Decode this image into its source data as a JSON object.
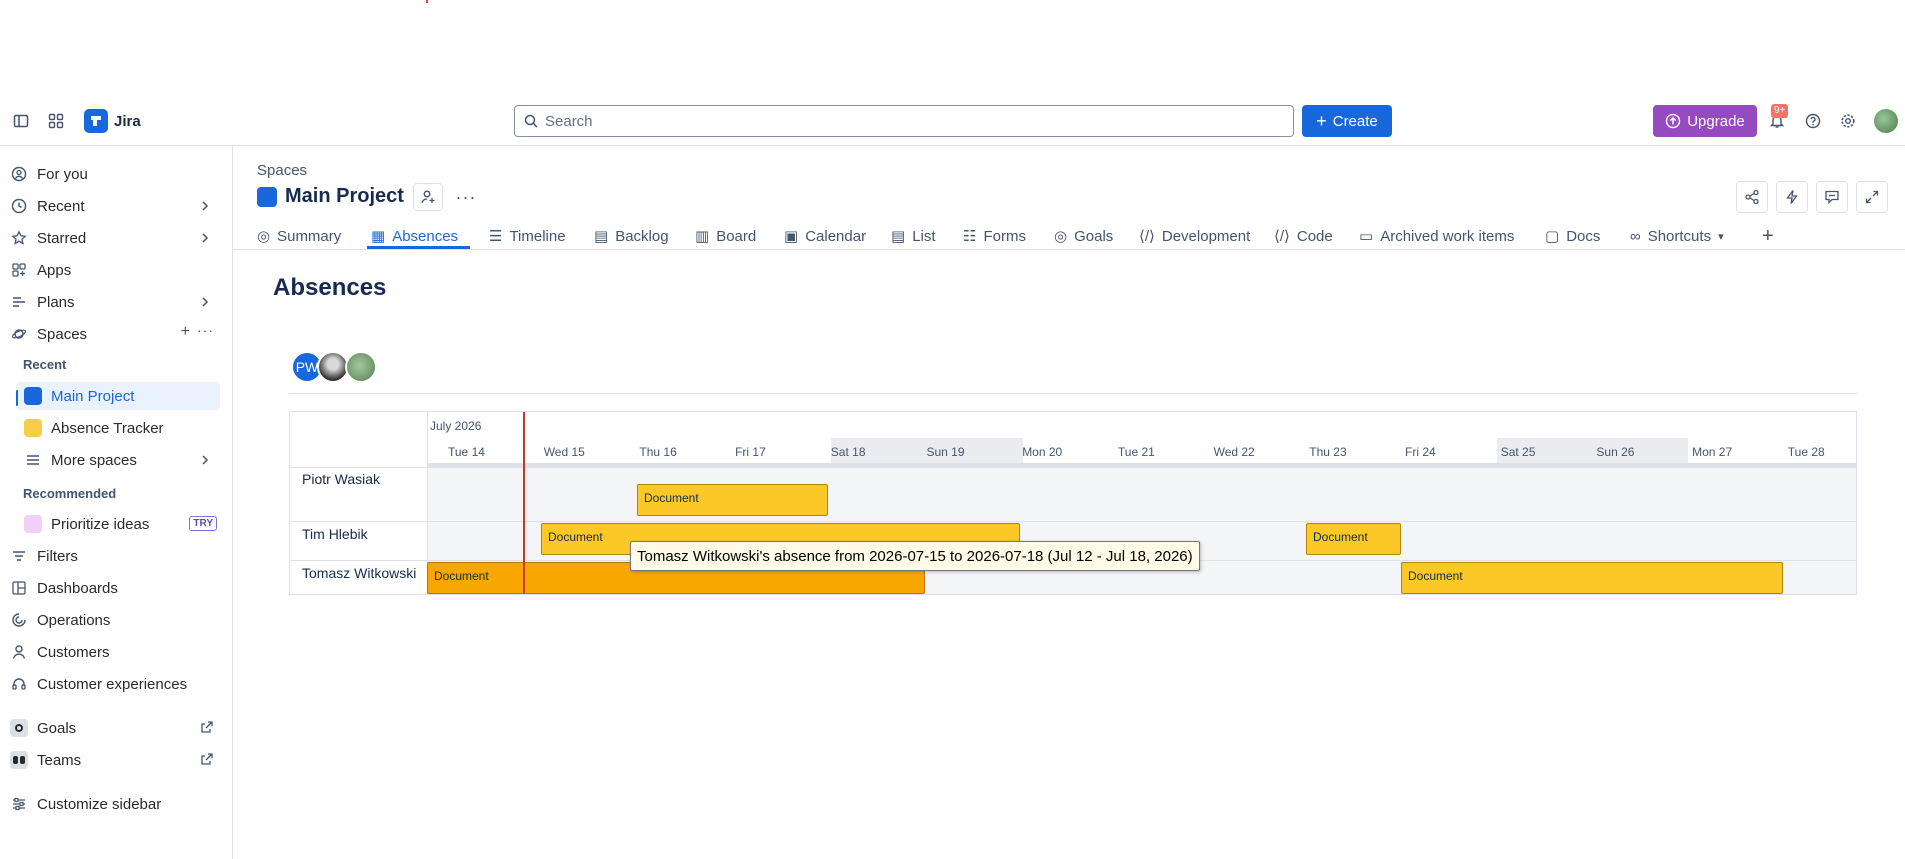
{
  "header": {
    "app_name": "Jira",
    "search_placeholder": "Search",
    "create_label": "Create",
    "upgrade_label": "Upgrade",
    "notifications_badge": "9+"
  },
  "sidebar": {
    "items": [
      {
        "label": "For you",
        "icon": "person-circle-icon"
      },
      {
        "label": "Recent",
        "icon": "clock-icon"
      },
      {
        "label": "Starred",
        "icon": "star-icon"
      },
      {
        "label": "Apps",
        "icon": "apps-icon"
      },
      {
        "label": "Plans",
        "icon": "plans-icon"
      },
      {
        "label": "Spaces",
        "icon": "spaces-icon"
      }
    ],
    "recent_heading": "Recent",
    "spaces": [
      {
        "label": "Main Project"
      },
      {
        "label": "Absence Tracker"
      },
      {
        "label": "More spaces"
      }
    ],
    "recommended_heading": "Recommended",
    "recommended": [
      {
        "label": "Prioritize ideas",
        "tag": "TRY"
      }
    ],
    "bottom_items": [
      {
        "label": "Filters"
      },
      {
        "label": "Dashboards"
      },
      {
        "label": "Operations"
      },
      {
        "label": "Customers"
      },
      {
        "label": "Customer experiences"
      },
      {
        "label": "Goals"
      },
      {
        "label": "Teams"
      },
      {
        "label": "Customize sidebar"
      }
    ]
  },
  "project": {
    "breadcrumb": "Spaces",
    "title": "Main Project"
  },
  "tabs": [
    {
      "label": "Summary"
    },
    {
      "label": "Absences"
    },
    {
      "label": "Timeline"
    },
    {
      "label": "Backlog"
    },
    {
      "label": "Board"
    },
    {
      "label": "Calendar"
    },
    {
      "label": "List"
    },
    {
      "label": "Forms"
    },
    {
      "label": "Goals"
    },
    {
      "label": "Development"
    },
    {
      "label": "Code"
    },
    {
      "label": "Archived work items"
    },
    {
      "label": "Docs"
    },
    {
      "label": "Shortcuts"
    }
  ],
  "page": {
    "heading": "Absences",
    "avatar_initials": "PW"
  },
  "gantt": {
    "month": "July 2026",
    "days": [
      "Tue 14",
      "Wed 15",
      "Thu 16",
      "Fri 17",
      "Sat 18",
      "Sun 19",
      "Mon 20",
      "Tue 21",
      "Wed 22",
      "Thu 23",
      "Fri 24",
      "Sat 25",
      "Sun 26",
      "Mon 27",
      "Tue 28"
    ],
    "people": [
      "Piotr Wasiak",
      "Tim Hlebik",
      "Tomasz Witkowski"
    ],
    "absences": [
      {
        "person": "Piotr Wasiak",
        "label": "Document"
      },
      {
        "person": "Tim Hlebik",
        "label": "Document"
      },
      {
        "person": "Tim Hlebik",
        "label": "Document"
      },
      {
        "person": "Tomasz Witkowski",
        "label": "Document"
      },
      {
        "person": "Tomasz Witkowski",
        "label": "Document"
      }
    ],
    "tooltip": "Tomasz Witkowski's absence from 2026-07-15 to 2026-07-18 (Jul 12 - Jul 18, 2026)"
  }
}
